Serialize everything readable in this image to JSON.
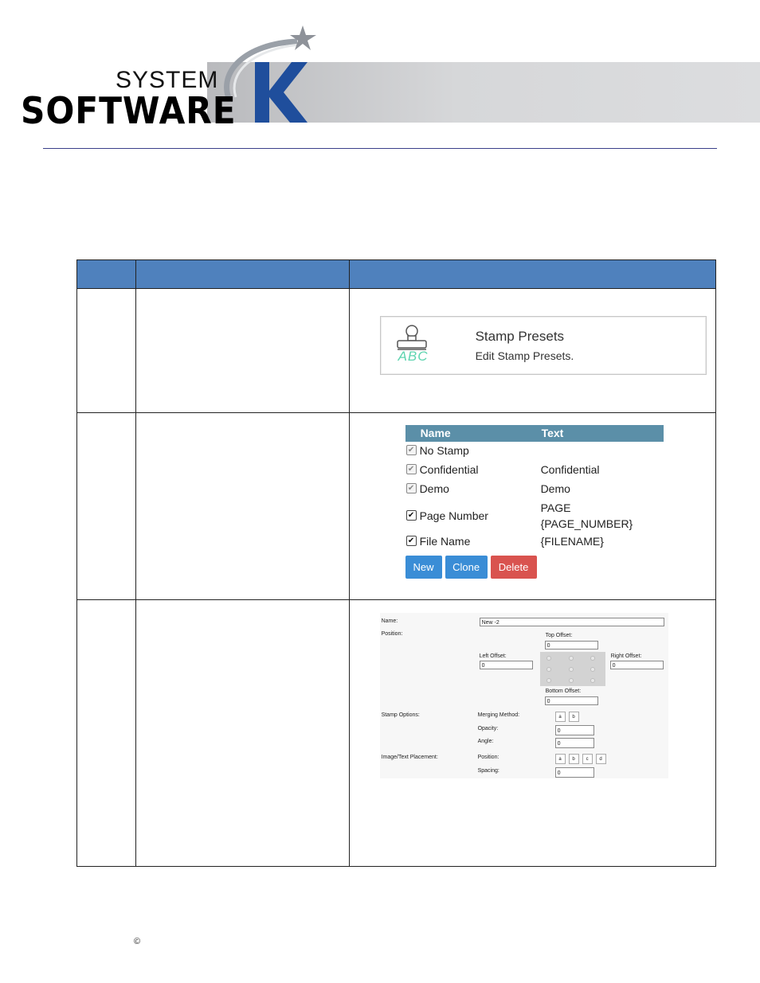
{
  "logo": {
    "system": "SYSTEM",
    "software": "SOFTWARE",
    "k": "K",
    "accent_color": "#1f4e9c"
  },
  "table": {
    "header_color": "#4f81bd",
    "headers": [
      "",
      "",
      ""
    ]
  },
  "stamp_presets_tile": {
    "title": "Stamp Presets",
    "subtitle": "Edit Stamp Presets.",
    "icon": "stamp-icon",
    "icon_text": "ABC"
  },
  "presets_list": {
    "col_name": "Name",
    "col_text": "Text",
    "items": [
      {
        "name": "No Stamp",
        "text": "",
        "checked": true,
        "locked": true
      },
      {
        "name": "Confidential",
        "text": "Confidential",
        "checked": true,
        "locked": true
      },
      {
        "name": "Demo",
        "text": "Demo",
        "checked": true,
        "locked": true
      },
      {
        "name": "Page Number",
        "text": "PAGE {PAGE_NUMBER}",
        "text_line1": "PAGE",
        "text_line2": "{PAGE_NUMBER}",
        "checked": true,
        "locked": false
      },
      {
        "name": "File Name",
        "text": "{FILENAME}",
        "checked": true,
        "locked": false
      }
    ],
    "buttons": {
      "new": "New",
      "clone": "Clone",
      "delete": "Delete"
    }
  },
  "stamp_form": {
    "name_label": "Name:",
    "name_value": "New -2",
    "position_label": "Position:",
    "top_offset_label": "Top Offset:",
    "top_offset_value": "0",
    "left_offset_label": "Left Offset:",
    "left_offset_value": "0",
    "right_offset_label": "Right Offset:",
    "right_offset_value": "0",
    "bottom_offset_label": "Bottom Offset:",
    "bottom_offset_value": "0",
    "stamp_options_label": "Stamp Options:",
    "merging_method_label": "Merging Method:",
    "merging_options": [
      "a",
      "b"
    ],
    "opacity_label": "Opacity:",
    "opacity_value": "0",
    "angle_label": "Angle:",
    "angle_value": "0",
    "placement_label": "Image/Text Placement:",
    "placement_position_label": "Position:",
    "placement_options": [
      "a",
      "b",
      "c",
      "d"
    ],
    "spacing_label": "Spacing:",
    "spacing_value": "0"
  },
  "footer": {
    "copyright": "©"
  }
}
